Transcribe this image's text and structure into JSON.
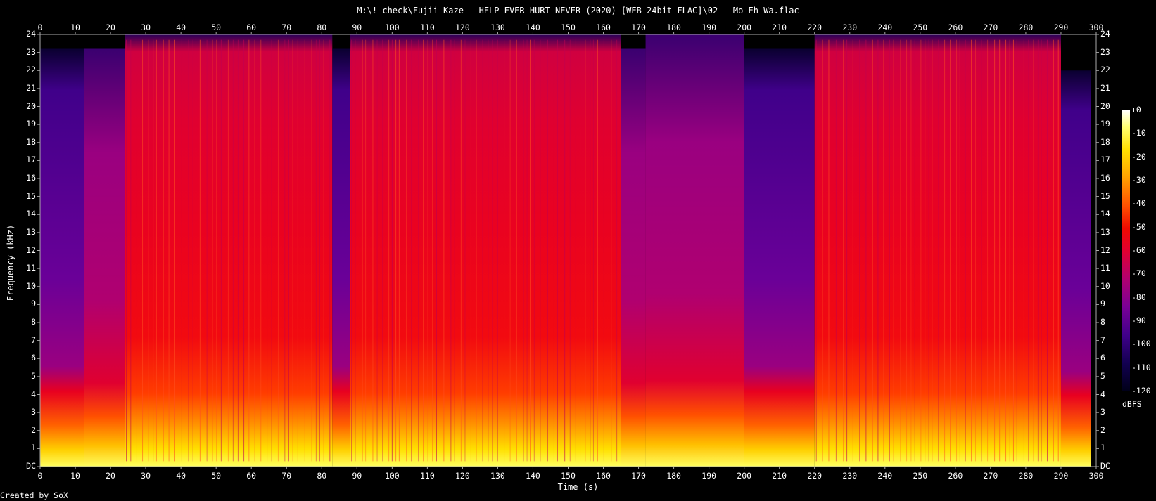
{
  "title": "M:\\! check\\Fujii Kaze - HELP EVER HURT NEVER (2020) [WEB 24bit FLAC]\\02 - Mo-Eh-Wa.flac",
  "footer": "Created by SoX",
  "colorbar": {
    "unit": "dBFS",
    "ticks": [
      "+0",
      "-10",
      "-20",
      "-30",
      "-40",
      "-50",
      "-60",
      "-70",
      "-80",
      "-90",
      "-100",
      "-110",
      "-120"
    ],
    "colors": [
      "#ffffff",
      "#ffff70",
      "#ffe000",
      "#ffa000",
      "#ff5000",
      "#f00a00",
      "#e20030",
      "#b20070",
      "#7a0096",
      "#40008a",
      "#120050",
      "#000018"
    ]
  },
  "chart_data": {
    "type": "heatmap",
    "title": "M:\\! check\\Fujii Kaze - HELP EVER HURT NEVER (2020) [WEB 24bit FLAC]\\02 - Mo-Eh-Wa.flac",
    "xlabel": "Time (s)",
    "ylabel": "Frequency (kHz)",
    "xlim": [
      0,
      300
    ],
    "ylim": [
      0,
      24
    ],
    "zlim": [
      -120,
      0
    ],
    "x_ticks": [
      "0",
      "10",
      "20",
      "30",
      "40",
      "50",
      "60",
      "70",
      "80",
      "90",
      "100",
      "110",
      "120",
      "130",
      "140",
      "150",
      "160",
      "170",
      "180",
      "190",
      "200",
      "210",
      "220",
      "230",
      "240",
      "250",
      "260",
      "270",
      "280",
      "290",
      "300"
    ],
    "y_ticks": [
      "DC",
      "1",
      "2",
      "3",
      "4",
      "5",
      "6",
      "7",
      "8",
      "9",
      "10",
      "11",
      "12",
      "13",
      "14",
      "15",
      "16",
      "17",
      "18",
      "19",
      "20",
      "21",
      "22",
      "23",
      "24"
    ],
    "track_end_s": 298.5,
    "segments": [
      {
        "start": 0,
        "end": 12.5,
        "high_freq_level": -92,
        "cutoff_khz": 23.2
      },
      {
        "start": 12.5,
        "end": 24,
        "high_freq_level": -70,
        "cutoff_khz": 23.2
      },
      {
        "start": 24,
        "end": 83,
        "high_freq_level": -50,
        "cutoff_khz": 24
      },
      {
        "start": 83,
        "end": 88,
        "high_freq_level": -85,
        "cutoff_khz": 23.2
      },
      {
        "start": 88,
        "end": 165,
        "high_freq_level": -50,
        "cutoff_khz": 24
      },
      {
        "start": 165,
        "end": 172,
        "high_freq_level": -75,
        "cutoff_khz": 23.2
      },
      {
        "start": 172,
        "end": 200,
        "high_freq_level": -58,
        "cutoff_khz": 24
      },
      {
        "start": 200,
        "end": 220,
        "high_freq_level": -85,
        "cutoff_khz": 23.2
      },
      {
        "start": 220,
        "end": 290,
        "high_freq_level": -50,
        "cutoff_khz": 24
      },
      {
        "start": 290,
        "end": 298.5,
        "high_freq_level": -95,
        "cutoff_khz": 22
      }
    ]
  }
}
